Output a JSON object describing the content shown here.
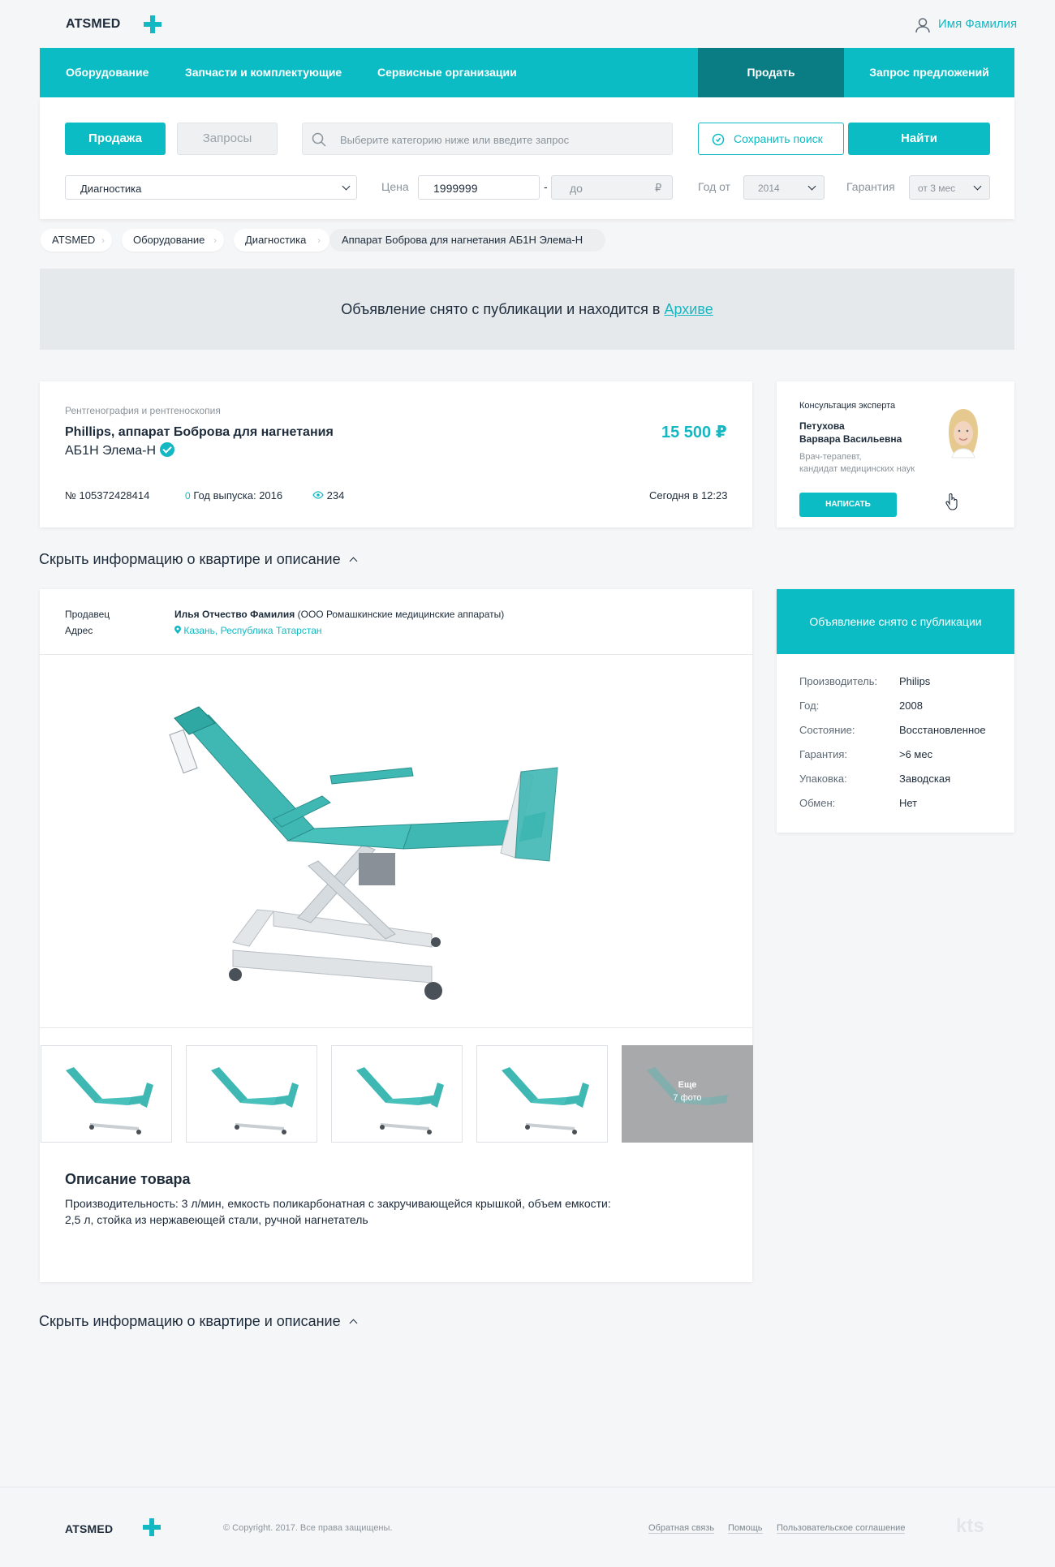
{
  "header": {
    "logo": "ATSMED",
    "user_name": "Имя Фамилия"
  },
  "nav": {
    "items": [
      "Оборудование",
      "Запчасти и комплектующие",
      "Сервисные организации"
    ],
    "sell": "Продать",
    "request": "Запрос предложений"
  },
  "search": {
    "tab_sale": "Продажа",
    "tab_requests": "Запросы",
    "placeholder": "Выберите категорию ниже или введите запрос",
    "save_search": "Сохранить поиск",
    "find": "Найти",
    "category": "Диагностика",
    "price_label": "Цена",
    "price_from": "1999999",
    "price_dash": "-",
    "price_to_placeholder": "до",
    "currency": "₽",
    "year_label": "Год от",
    "year_value": "2014",
    "warranty_label": "Гарантия",
    "warranty_value": "от 3 мес"
  },
  "breadcrumbs": [
    "ATSMED",
    "Оборудование",
    "Диагностика",
    "Аппарат Боброва для нагнетания АБ1Н Элема-Н"
  ],
  "banner": {
    "text": "Объявление снято с публикации и находится в",
    "link": "Архиве"
  },
  "listing": {
    "category": "Рентгенография и рентгеноскопия",
    "title_line1": "Phillips, аппарат Боброва для нагнетания",
    "title_line2": "АБ1Н Элема-Н",
    "price": "15 500 ₽",
    "number": "№ 105372428414",
    "year": "Год выпуска: 2016",
    "views": "234",
    "date": "Сегодня в 12:23"
  },
  "expert": {
    "heading": "Консультация эксперта",
    "name_line1": "Петухова",
    "name_line2": "Варвара Васильевна",
    "role_line1": "Врач-терапевт,",
    "role_line2": "кандидат медицинских наук",
    "button": "НАПИСАТЬ"
  },
  "section_toggle": "Скрыть информацию о квартире и описание",
  "seller": {
    "seller_label": "Продавец",
    "seller_name": "Илья Отчество Фамилия",
    "seller_org": "(ООО Ромашкинские медицинские аппараты)",
    "address_label": "Адрес",
    "address": "Казань, Республика Татарстан"
  },
  "thumbs": {
    "more_line1": "Еще",
    "more_line2": "7 фото"
  },
  "description": {
    "heading": "Описание товара",
    "line1": "Производительность: 3 л/мин, емкость поликарбонатная с закручивающейся крышкой, объем емкости:",
    "line2": "2,5 л, стойка из нержавеющей стали, ручной нагнетатель"
  },
  "status_card": {
    "title": "Объявление снято с публикации",
    "specs": [
      {
        "label": "Производитель:",
        "value": "Philips"
      },
      {
        "label": "Год:",
        "value": "2008"
      },
      {
        "label": "Состояние:",
        "value": "Восстановленное"
      },
      {
        "label": "Гарантия:",
        "value": ">6 мес"
      },
      {
        "label": "Упаковка:",
        "value": "Заводская"
      },
      {
        "label": "Обмен:",
        "value": "Нет"
      }
    ]
  },
  "footer": {
    "logo": "ATSMED",
    "copyright": "© Copyright. 2017. Все права защищены.",
    "links": [
      "Обратная связь",
      "Помощь",
      "Пользовательское соглашение"
    ],
    "brand": "kts"
  },
  "colors": {
    "accent": "#0bbcc4",
    "accent_dark": "#0a7d84",
    "text": "#1d2b3a"
  }
}
